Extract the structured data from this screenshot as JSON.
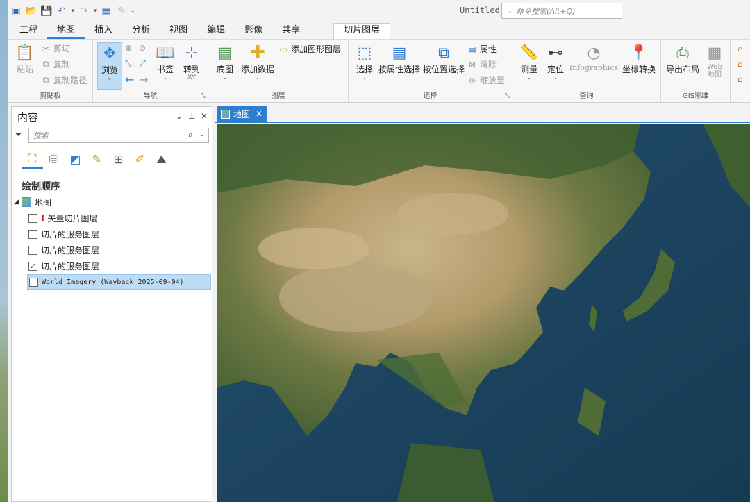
{
  "window": {
    "title": "Untitled",
    "command_search_placeholder": "命令搜索(Alt+Q)"
  },
  "ribbon_tabs": [
    "工程",
    "地图",
    "插入",
    "分析",
    "视图",
    "编辑",
    "影像",
    "共享"
  ],
  "active_tab": "地图",
  "contextual_tab": "切片图层",
  "groups": {
    "clipboard": {
      "label": "剪贴板",
      "paste": "粘贴",
      "cut": "剪切",
      "copy": "复制",
      "copy_path": "复制路径"
    },
    "navigate": {
      "label": "导航",
      "explore": "浏览",
      "bookmarks": "书签",
      "goto_xy": "转到",
      "goto_xy_sub": "XY"
    },
    "layer": {
      "label": "图层",
      "basemap": "底图",
      "add_data": "添加数据",
      "add_graphics_layer": "添加图形图层"
    },
    "selection": {
      "label": "选择",
      "select": "选择",
      "select_by_attributes": "按属性选择",
      "select_by_location": "按位置选择",
      "attributes": "属性",
      "clear": "清除",
      "zoom_to": "缩放至"
    },
    "inquiry": {
      "label": "查询",
      "measure": "测量",
      "locate": "定位",
      "infographics": "Infographics",
      "convert_coordinates": "坐标转换"
    },
    "gis_thinking": {
      "label": "GIS思维",
      "export_layout": "导出布局",
      "web_map_line1": "Web",
      "web_map_line2": "地图"
    }
  },
  "contents_pane": {
    "title": "内容",
    "search_placeholder": "搜索",
    "section_title": "绘制顺序",
    "map_node": "地图",
    "layers": [
      {
        "name": "矢量切片图层",
        "checked": false,
        "warning": true
      },
      {
        "name": "切片的服务图层",
        "checked": false,
        "warning": false
      },
      {
        "name": "切片的服务图层",
        "checked": false,
        "warning": false
      },
      {
        "name": "切片的服务图层",
        "checked": true,
        "warning": false
      },
      {
        "name": "World Imagery (Wayback 2025-09-04)",
        "checked": false,
        "warning": false,
        "selected": true
      }
    ]
  },
  "view_tab": {
    "label": "地图"
  },
  "colors": {
    "accent": "#2c7fd1",
    "selection": "#bfdcf5",
    "ocean": "#1c4a66"
  }
}
